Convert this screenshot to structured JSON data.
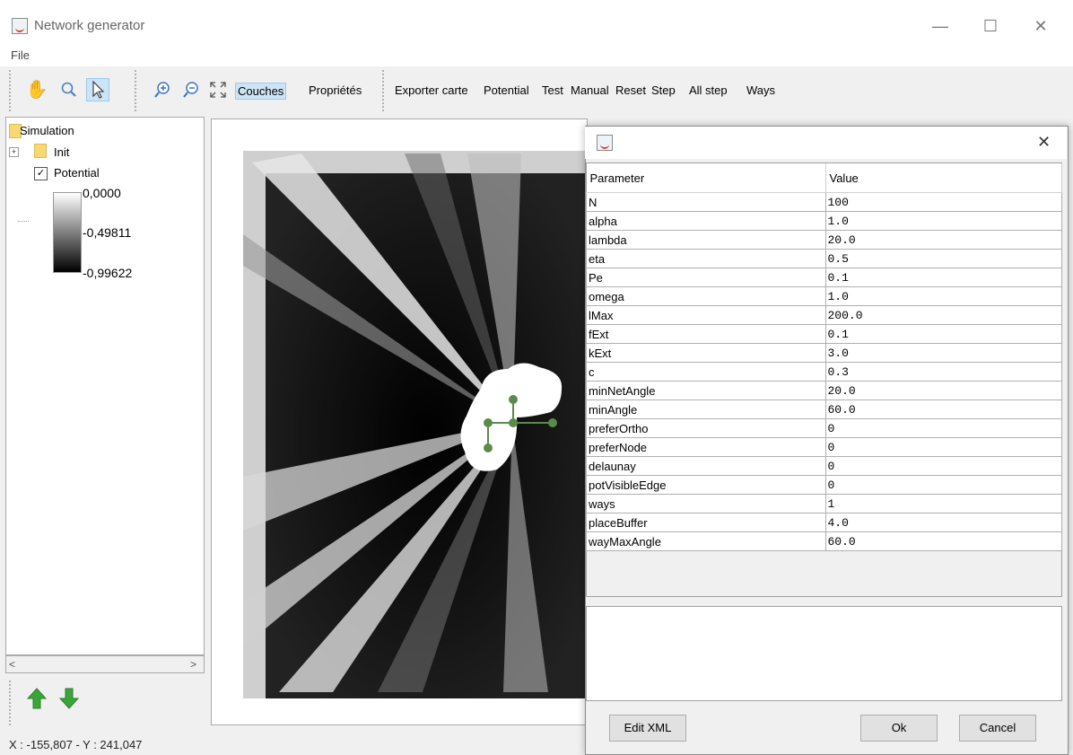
{
  "window": {
    "title": "Network generator"
  },
  "menu": {
    "file": "File"
  },
  "toolbar": {
    "tools": [
      "pan-hand",
      "zoom-lens",
      "select-arrow",
      "zoom-in",
      "zoom-out",
      "fit-extent"
    ],
    "couches": "Couches",
    "proprietes": "Propriétés",
    "actions": [
      "Exporter carte",
      "Potential",
      "Test",
      "Manual",
      "Reset",
      "Step",
      "All step",
      "Ways"
    ]
  },
  "tree": {
    "root": "Simulation",
    "init": "Init",
    "layer": "Potential",
    "layer_checked": true,
    "legend": {
      "max": "0,0000",
      "mid": "-0,49811",
      "min": "-0,99622"
    }
  },
  "status": {
    "coords": "X : -155,807 - Y : 241,047"
  },
  "dialog": {
    "headers": {
      "parameter": "Parameter",
      "value": "Value"
    },
    "rows": [
      [
        "N",
        "100"
      ],
      [
        "alpha",
        "1.0"
      ],
      [
        "lambda",
        "20.0"
      ],
      [
        "eta",
        "0.5"
      ],
      [
        "Pe",
        "0.1"
      ],
      [
        "omega",
        "1.0"
      ],
      [
        "lMax",
        "200.0"
      ],
      [
        "fExt",
        "0.1"
      ],
      [
        "kExt",
        "3.0"
      ],
      [
        "c",
        "0.3"
      ],
      [
        "minNetAngle",
        "20.0"
      ],
      [
        "minAngle",
        "60.0"
      ],
      [
        "preferOrtho",
        "0"
      ],
      [
        "preferNode",
        "0"
      ],
      [
        "delaunay",
        "0"
      ],
      [
        "potVisibleEdge",
        "0"
      ],
      [
        "ways",
        "1"
      ],
      [
        "placeBuffer",
        "4.0"
      ],
      [
        "wayMaxAngle",
        "60.0"
      ]
    ],
    "edit_xml": "Edit XML",
    "ok": "Ok",
    "cancel": "Cancel"
  },
  "colors": {
    "accent": "#cde4f7",
    "node": "#5c8a4a",
    "arrow_green": "#3aa63a"
  }
}
